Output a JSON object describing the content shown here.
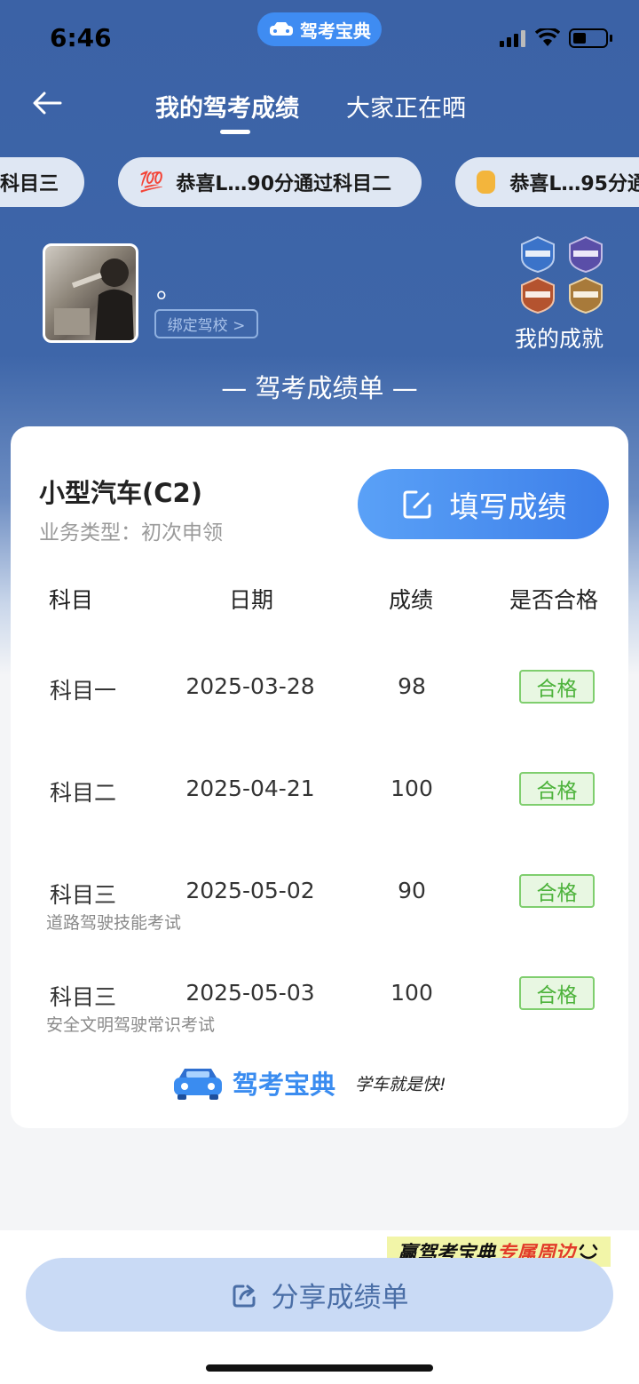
{
  "status": {
    "time": "6:46",
    "app_pill": "驾考宝典"
  },
  "nav": {
    "tabs": [
      {
        "label": "我的驾考成绩"
      },
      {
        "label": "大家正在晒"
      }
    ]
  },
  "ticker": [
    {
      "text": "科目三",
      "icon": ""
    },
    {
      "text": "恭喜L…90分通过科目二",
      "icon": "💯"
    },
    {
      "text": "恭喜L…95分通",
      "icon": "clap"
    }
  ],
  "profile": {
    "username": "。",
    "bind_school": "绑定驾校 >",
    "achievements_label": "我的成就"
  },
  "section_title": "— 驾考成绩单 —",
  "card": {
    "car_type": "小型汽车(C2)",
    "business_type": "业务类型：初次申领",
    "fill_button": "填写成绩",
    "headers": [
      "科目",
      "日期",
      "成绩",
      "是否合格"
    ],
    "rows": [
      {
        "subject": "科目一",
        "date": "2025-03-28",
        "score": "98",
        "pass": "合格",
        "sub": ""
      },
      {
        "subject": "科目二",
        "date": "2025-04-21",
        "score": "100",
        "pass": "合格",
        "sub": ""
      },
      {
        "subject": "科目三",
        "date": "2025-05-02",
        "score": "90",
        "pass": "合格",
        "sub": "道路驾驶技能考试"
      },
      {
        "subject": "科目三",
        "date": "2025-05-03",
        "score": "100",
        "pass": "合格",
        "sub": "安全文明驾驶常识考试"
      }
    ],
    "logo_text": "驾考宝典",
    "slogan": "学车就是快!"
  },
  "promo": {
    "part1": "赢驾考宝典",
    "part2": "专属周边"
  },
  "share_button": "分享成绩单",
  "colors": {
    "hero": "#3b62a6",
    "accent": "#3d7fe9",
    "pass": "#4cb23a"
  }
}
